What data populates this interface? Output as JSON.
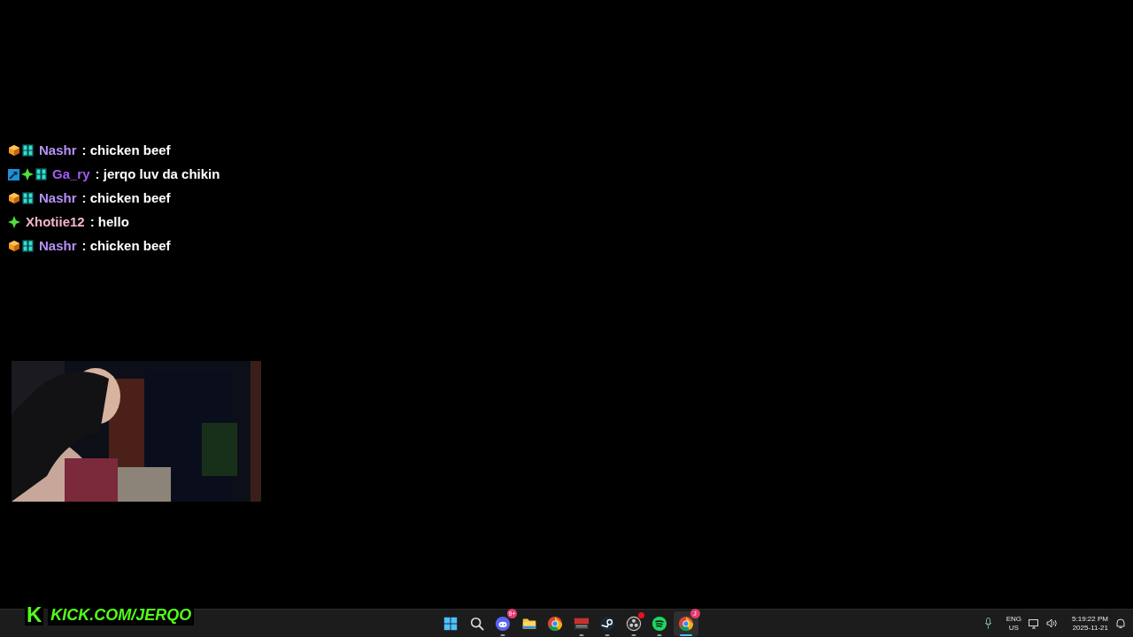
{
  "chat": [
    {
      "badges": [
        {
          "kind": "box"
        },
        {
          "kind": "grid"
        }
      ],
      "user": "Nashr",
      "color": "#b692f6",
      "message": ": chicken beef"
    },
    {
      "badges": [
        {
          "kind": "hammer"
        },
        {
          "kind": "sparkle"
        },
        {
          "kind": "grid"
        }
      ],
      "user": "Ga_ry",
      "color": "#a35df2",
      "message": ": jerqo luv da chikin"
    },
    {
      "badges": [
        {
          "kind": "box"
        },
        {
          "kind": "grid"
        }
      ],
      "user": "Nashr",
      "color": "#b692f6",
      "message": ": chicken beef"
    },
    {
      "badges": [
        {
          "kind": "sparkle"
        }
      ],
      "user": "Xhotiie12",
      "color": "#f4b6c8",
      "message": ": hello"
    },
    {
      "badges": [
        {
          "kind": "box"
        },
        {
          "kind": "grid"
        }
      ],
      "user": "Nashr",
      "color": "#b692f6",
      "message": ": chicken beef"
    }
  ],
  "overlay": {
    "logo": "K",
    "url": "KICK.COM/JERQO"
  },
  "taskbar": {
    "apps": [
      {
        "kind": "start",
        "running": false,
        "selected": false
      },
      {
        "kind": "search",
        "running": false,
        "selected": false
      },
      {
        "kind": "discord",
        "running": true,
        "selected": false,
        "badge": "9+"
      },
      {
        "kind": "folder",
        "running": false,
        "selected": false
      },
      {
        "kind": "chrome",
        "running": false,
        "selected": false
      },
      {
        "kind": "mixer",
        "running": true,
        "selected": false
      },
      {
        "kind": "steam",
        "running": true,
        "selected": false
      },
      {
        "kind": "obs",
        "running": true,
        "selected": false,
        "dot": true
      },
      {
        "kind": "spotify",
        "running": true,
        "selected": false
      },
      {
        "kind": "chrome",
        "running": true,
        "selected": true,
        "badge": "J"
      }
    ],
    "tray": {
      "language": "ENG",
      "region": "US",
      "time": "5:19:22 PM",
      "date": "2025-11-21"
    }
  }
}
